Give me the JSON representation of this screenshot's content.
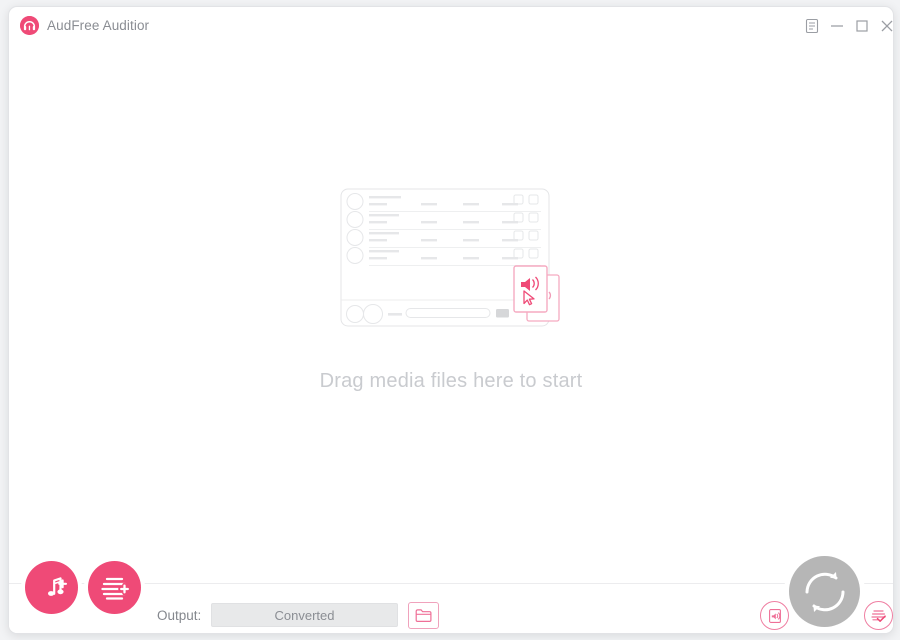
{
  "window": {
    "title": "AudFree Auditior",
    "app_icon": "headphones-icon",
    "controls": {
      "menu": "menu-icon",
      "minimize": "minimize-icon",
      "maximize": "maximize-icon",
      "close": "close-icon"
    }
  },
  "main": {
    "drop_hint": "Drag media files here to start",
    "illustration": "media-player-drop-illustration"
  },
  "toolbar": {
    "add_files_label": "add-music-file-icon",
    "add_folder_label": "add-playlist-icon",
    "output_label": "Output:",
    "output_value": "Converted",
    "output_placeholder": "Converted",
    "browse_icon": "folder-icon",
    "convert_icon": "refresh-convert-icon",
    "converted_list_icon": "audio-document-icon",
    "history_icon": "list-check-icon"
  },
  "colors": {
    "accent": "#ef4a77",
    "accent_light": "#ef7fa2",
    "convert_gray": "#b6b6b6",
    "hint_text": "#c9cbcf",
    "title_text": "#8a8d93",
    "field_bg": "#e8e9ea"
  }
}
